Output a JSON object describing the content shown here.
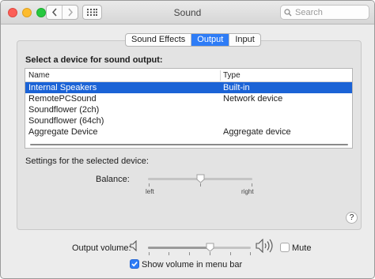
{
  "window": {
    "title": "Sound",
    "search_placeholder": "Search"
  },
  "tabs": [
    {
      "label": "Sound Effects",
      "active": false
    },
    {
      "label": "Output",
      "active": true
    },
    {
      "label": "Input",
      "active": false
    }
  ],
  "output": {
    "section_title": "Select a device for sound output:",
    "columns": [
      "Name",
      "Type"
    ],
    "devices": [
      {
        "name": "Internal Speakers",
        "type": "Built-in",
        "selected": true
      },
      {
        "name": "RemotePCSound",
        "type": "Network device",
        "selected": false
      },
      {
        "name": "Soundflower (2ch)",
        "type": "",
        "selected": false
      },
      {
        "name": "Soundflower (64ch)",
        "type": "",
        "selected": false
      },
      {
        "name": "Aggregate Device",
        "type": "Aggregate device",
        "selected": false
      }
    ],
    "settings_title": "Settings for the selected device:",
    "balance": {
      "label": "Balance:",
      "left_label": "left",
      "right_label": "right",
      "value": 0.5
    },
    "help_label": "?"
  },
  "volume": {
    "label": "Output volume:",
    "value": 0.6,
    "mute_label": "Mute",
    "mute_checked": false,
    "menu_bar_label": "Show volume in menu bar",
    "menu_bar_checked": true
  },
  "colors": {
    "accent": "#2e7cf6",
    "selection": "#1b63d6"
  },
  "icons": [
    "back-icon",
    "forward-icon",
    "grid-icon",
    "search-icon",
    "volume-low-icon",
    "volume-high-icon",
    "checkmark-icon"
  ]
}
